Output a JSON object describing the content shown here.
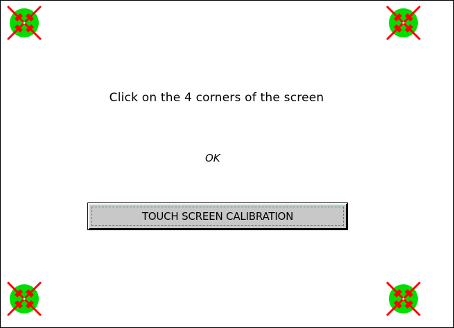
{
  "screen": {
    "instruction": "Click on the 4 corners of the screen",
    "status": "OK",
    "button_label": "TOUCH SCREEN CALIBRATION"
  },
  "targets": [
    {
      "corner": "top-left",
      "icon": "calibration-target-icon"
    },
    {
      "corner": "top-right",
      "icon": "calibration-target-icon"
    },
    {
      "corner": "bottom-left",
      "icon": "calibration-target-icon"
    },
    {
      "corner": "bottom-right",
      "icon": "calibration-target-icon"
    }
  ],
  "colors": {
    "background": "#ffffff",
    "target_circle": "#00dd00",
    "target_cross": "#ff0000",
    "button_face": "#c8c8c8",
    "focus_ring": "#2f8f8f"
  }
}
